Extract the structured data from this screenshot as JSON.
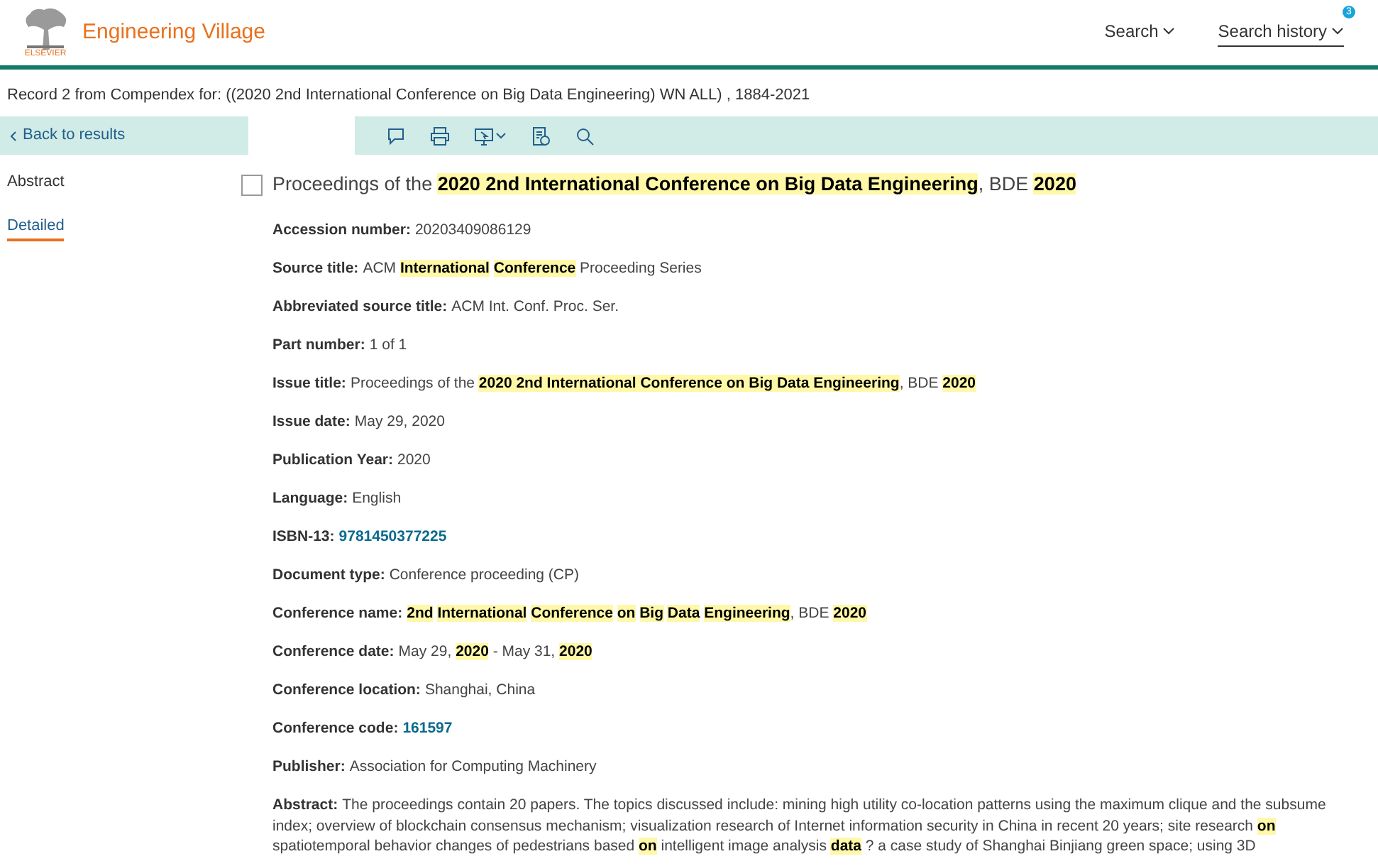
{
  "header": {
    "publisher": "ELSEVIER",
    "product": "Engineering Village",
    "nav": [
      {
        "label": "Search",
        "underlined": false
      },
      {
        "label": "Search history",
        "underlined": true,
        "badge": "3"
      }
    ]
  },
  "record_line": "Record 2 from Compendex for: ((2020 2nd International Conference on Big Data Engineering) WN ALL) , 1884-2021",
  "back_link": "Back to results",
  "sidebar": [
    {
      "label": "Abstract",
      "selected": false
    },
    {
      "label": "Detailed",
      "selected": true
    }
  ],
  "record": {
    "checked": false,
    "title": "Proceedings of the **2020 2nd International Conference on Big Data Engineering**, BDE **2020**",
    "fields": [
      {
        "label": "Accession number:",
        "kind": "text",
        "value": "20203409086129"
      },
      {
        "label": "Source title:",
        "kind": "text",
        "value": "ACM **International** **Conference** Proceeding Series"
      },
      {
        "label": "Abbreviated source title:",
        "kind": "text",
        "value": "ACM Int. Conf. Proc. Ser."
      },
      {
        "label": "Part number:",
        "kind": "text",
        "value": "1 of 1"
      },
      {
        "label": "Issue title:",
        "kind": "text",
        "value": "Proceedings of the **2020 2nd International Conference on Big Data Engineering**, BDE **2020**"
      },
      {
        "label": "Issue date:",
        "kind": "text",
        "value": "May 29, 2020"
      },
      {
        "label": "Publication Year:",
        "kind": "text",
        "value": "2020"
      },
      {
        "label": "Language:",
        "kind": "text",
        "value": "English"
      },
      {
        "label": "ISBN-13:",
        "kind": "link",
        "value": "9781450377225"
      },
      {
        "label": "Document type:",
        "kind": "text",
        "value": "Conference proceeding (CP)"
      },
      {
        "label": "Conference name:",
        "kind": "text",
        "value": "**2nd** **International** **Conference** **on** **Big** **Data** **Engineering**, BDE **2020**"
      },
      {
        "label": "Conference date:",
        "kind": "text",
        "value": "May 29, **2020** - May 31, **2020**"
      },
      {
        "label": "Conference location:",
        "kind": "text",
        "value": "Shanghai, China"
      },
      {
        "label": "Conference code:",
        "kind": "link",
        "value": "161597"
      },
      {
        "label": "Publisher:",
        "kind": "text",
        "value": "Association for Computing Machinery"
      },
      {
        "label": "Abstract:",
        "kind": "text",
        "value": "The proceedings contain 20 papers. The topics discussed include: mining high utility co-location patterns using the maximum clique and the subsume index; overview of blockchain consensus mechanism; visualization research of Internet information security in China in recent 20 years; site research **on** spatiotemporal behavior changes of pedestrians based **on** intelligent image analysis **data** ? a case study of Shanghai Binjiang green space; using 3D"
      }
    ]
  }
}
